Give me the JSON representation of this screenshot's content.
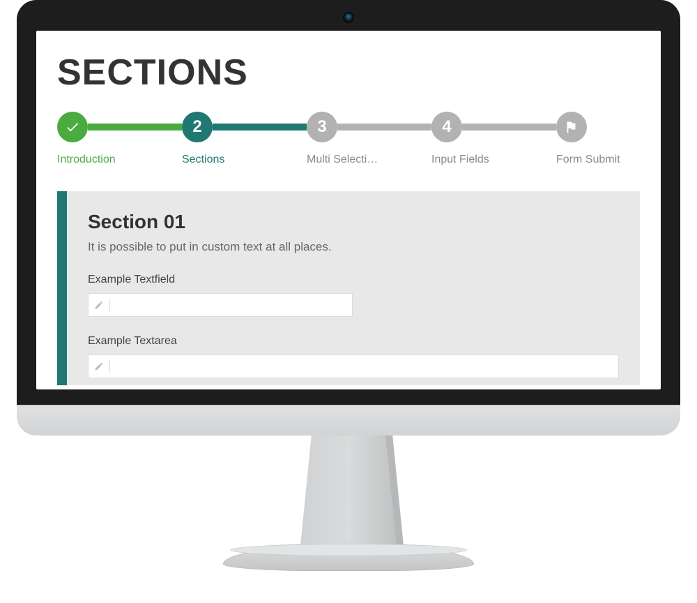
{
  "page": {
    "title": "SECTIONS"
  },
  "stepper": {
    "steps": [
      {
        "label": "Introduction",
        "state": "done",
        "indicator": "check"
      },
      {
        "label": "Sections",
        "state": "active",
        "indicator": "2"
      },
      {
        "label": "Multi Selecti…",
        "state": "idle",
        "indicator": "3"
      },
      {
        "label": "Input Fields",
        "state": "idle",
        "indicator": "4"
      },
      {
        "label": "Form Submit",
        "state": "idle",
        "indicator": "flag"
      }
    ]
  },
  "card": {
    "title": "Section 01",
    "description": "It is possible to put in custom text at all places.",
    "fields": [
      {
        "label": "Example Textfield",
        "value": "",
        "type": "text"
      },
      {
        "label": "Example Textarea",
        "value": "",
        "type": "textarea"
      }
    ],
    "accent_color": "#1f7872"
  },
  "colors": {
    "done": "#4aab3f",
    "active": "#1f7872",
    "idle": "#b2b2b2"
  }
}
